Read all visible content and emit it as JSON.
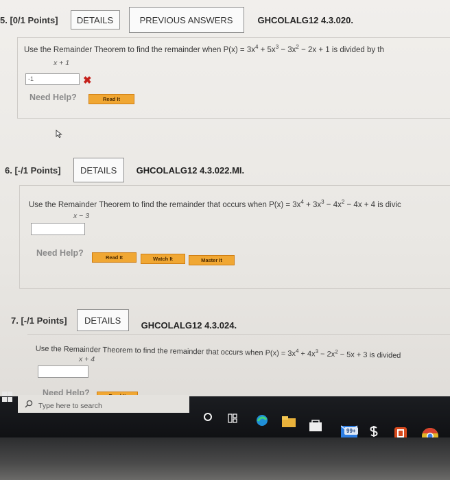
{
  "q5": {
    "number": "5. [0/1 Points]",
    "details": "DETAILS",
    "previous_answers": "PREVIOUS ANSWERS",
    "code": "GHCOLALG12 4.3.020.",
    "text_pre": "Use the Remainder Theorem to find the remainder when P(x) = 3x",
    "text_post": "+ 5x",
    "text_post2": "− 3x",
    "text_post3": "− 2x + 1 is divided by th",
    "exp1": "4",
    "exp2": "3",
    "exp3": "2",
    "divisor": "x + 1",
    "answer": "-1",
    "wrong_mark": "✖",
    "need_help": "Need Help?",
    "read_it": "Read It"
  },
  "q6": {
    "number": "6. [-/1 Points]",
    "details": "DETAILS",
    "code": "GHCOLALG12 4.3.022.MI.",
    "text_pre": "Use the Remainder Theorem to find the remainder that occurs when P(x) = 3x",
    "text_post": "+ 3x",
    "text_post2": "− 4x",
    "text_post3": "− 4x + 4 is divic",
    "exp1": "4",
    "exp2": "3",
    "exp3": "2",
    "divisor": "x − 3",
    "need_help": "Need Help?",
    "read_it": "Read It",
    "watch_it": "Watch It",
    "master_it": "Master It"
  },
  "q7": {
    "number": "7. [-/1 Points]",
    "details": "DETAILS",
    "code": "GHCOLALG12 4.3.024.",
    "text_pre": "Use the Remainder Theorem to find the remainder that occurs when P(x) = 3x",
    "text_post": "+ 4x",
    "text_post2": "− 2x",
    "text_post3": "− 5x + 3 is divided",
    "exp1": "4",
    "exp2": "3",
    "exp3": "2",
    "divisor": "x + 4",
    "need_help": "Need Help?",
    "read_it": "Read It"
  },
  "taskbar": {
    "search_placeholder": "Type here to search",
    "badge": "99+"
  }
}
